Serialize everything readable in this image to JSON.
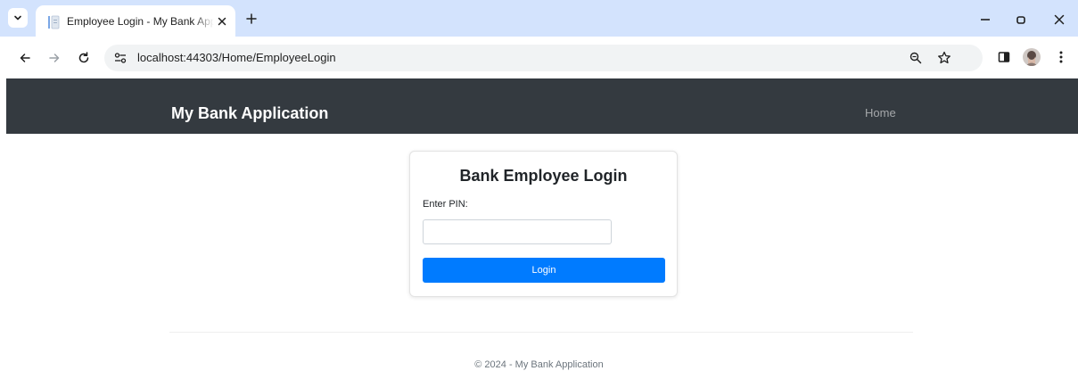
{
  "browser": {
    "tab": {
      "title": "Employee Login - My Bank Application",
      "favicon": "page-icon",
      "close_icon": "close-icon"
    },
    "address_bar": {
      "url": "localhost:44303/Home/EmployeeLogin",
      "site_info_icon": "tune-icon"
    },
    "icons": [
      "tab-search-icon",
      "new-tab-icon",
      "minimize-icon",
      "restore-icon",
      "close-window-icon",
      "back-icon",
      "forward-icon",
      "reload-icon",
      "zoom-icon",
      "bookmark-star-icon",
      "side-panel-icon",
      "profile-avatar",
      "menu-icon"
    ],
    "tab_strip_color": "#d3e3fd"
  },
  "page": {
    "navbar": {
      "brand": "My Bank Application",
      "links": [
        {
          "label": "Home"
        }
      ],
      "background": "#343a40"
    },
    "login": {
      "title": "Bank Employee Login",
      "pin_label": "Enter PIN:",
      "pin_value": "",
      "button_label": "Login",
      "button_color": "#007bff"
    },
    "footer": {
      "text": "© 2024 - My Bank Application"
    }
  }
}
